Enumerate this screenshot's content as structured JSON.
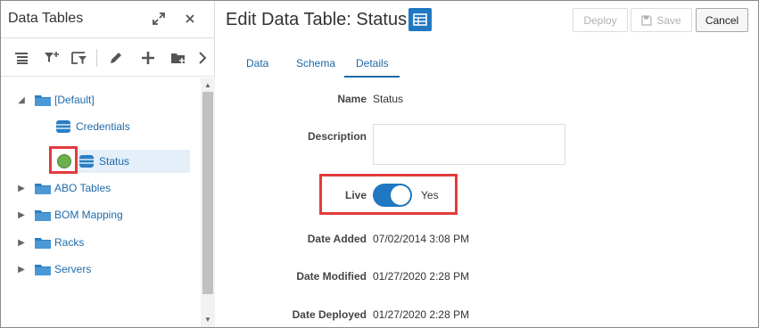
{
  "left_panel": {
    "title": "Data Tables",
    "tree": [
      {
        "label": "[Default]",
        "expanded": true
      },
      {
        "label": "Credentials"
      },
      {
        "label": "Status",
        "selected": true,
        "status_color": "#6ab04c"
      },
      {
        "label": "ABO Tables",
        "expanded": false
      },
      {
        "label": "BOM Mapping",
        "expanded": false
      },
      {
        "label": "Racks",
        "expanded": false
      },
      {
        "label": "Servers",
        "expanded": false
      }
    ]
  },
  "header": {
    "title": "Edit Data Table: Status",
    "deploy_label": "Deploy",
    "save_label": "Save",
    "cancel_label": "Cancel"
  },
  "tabs": [
    "Data",
    "Schema",
    "Details"
  ],
  "active_tab": "Details",
  "details": {
    "name_label": "Name",
    "name_value": "Status",
    "description_label": "Description",
    "description_value": "",
    "live_label": "Live",
    "live_value": "Yes",
    "date_added_label": "Date Added",
    "date_added_value": "07/02/2014 3:08 PM",
    "date_modified_label": "Date Modified",
    "date_modified_value": "01/27/2020 2:28 PM",
    "date_deployed_label": "Date Deployed",
    "date_deployed_value": "01/27/2020 2:28 PM"
  },
  "colors": {
    "accent": "#1f78c1",
    "link": "#1d6aa8",
    "highlight": "#e23b3b",
    "status_green": "#6ab04c"
  }
}
